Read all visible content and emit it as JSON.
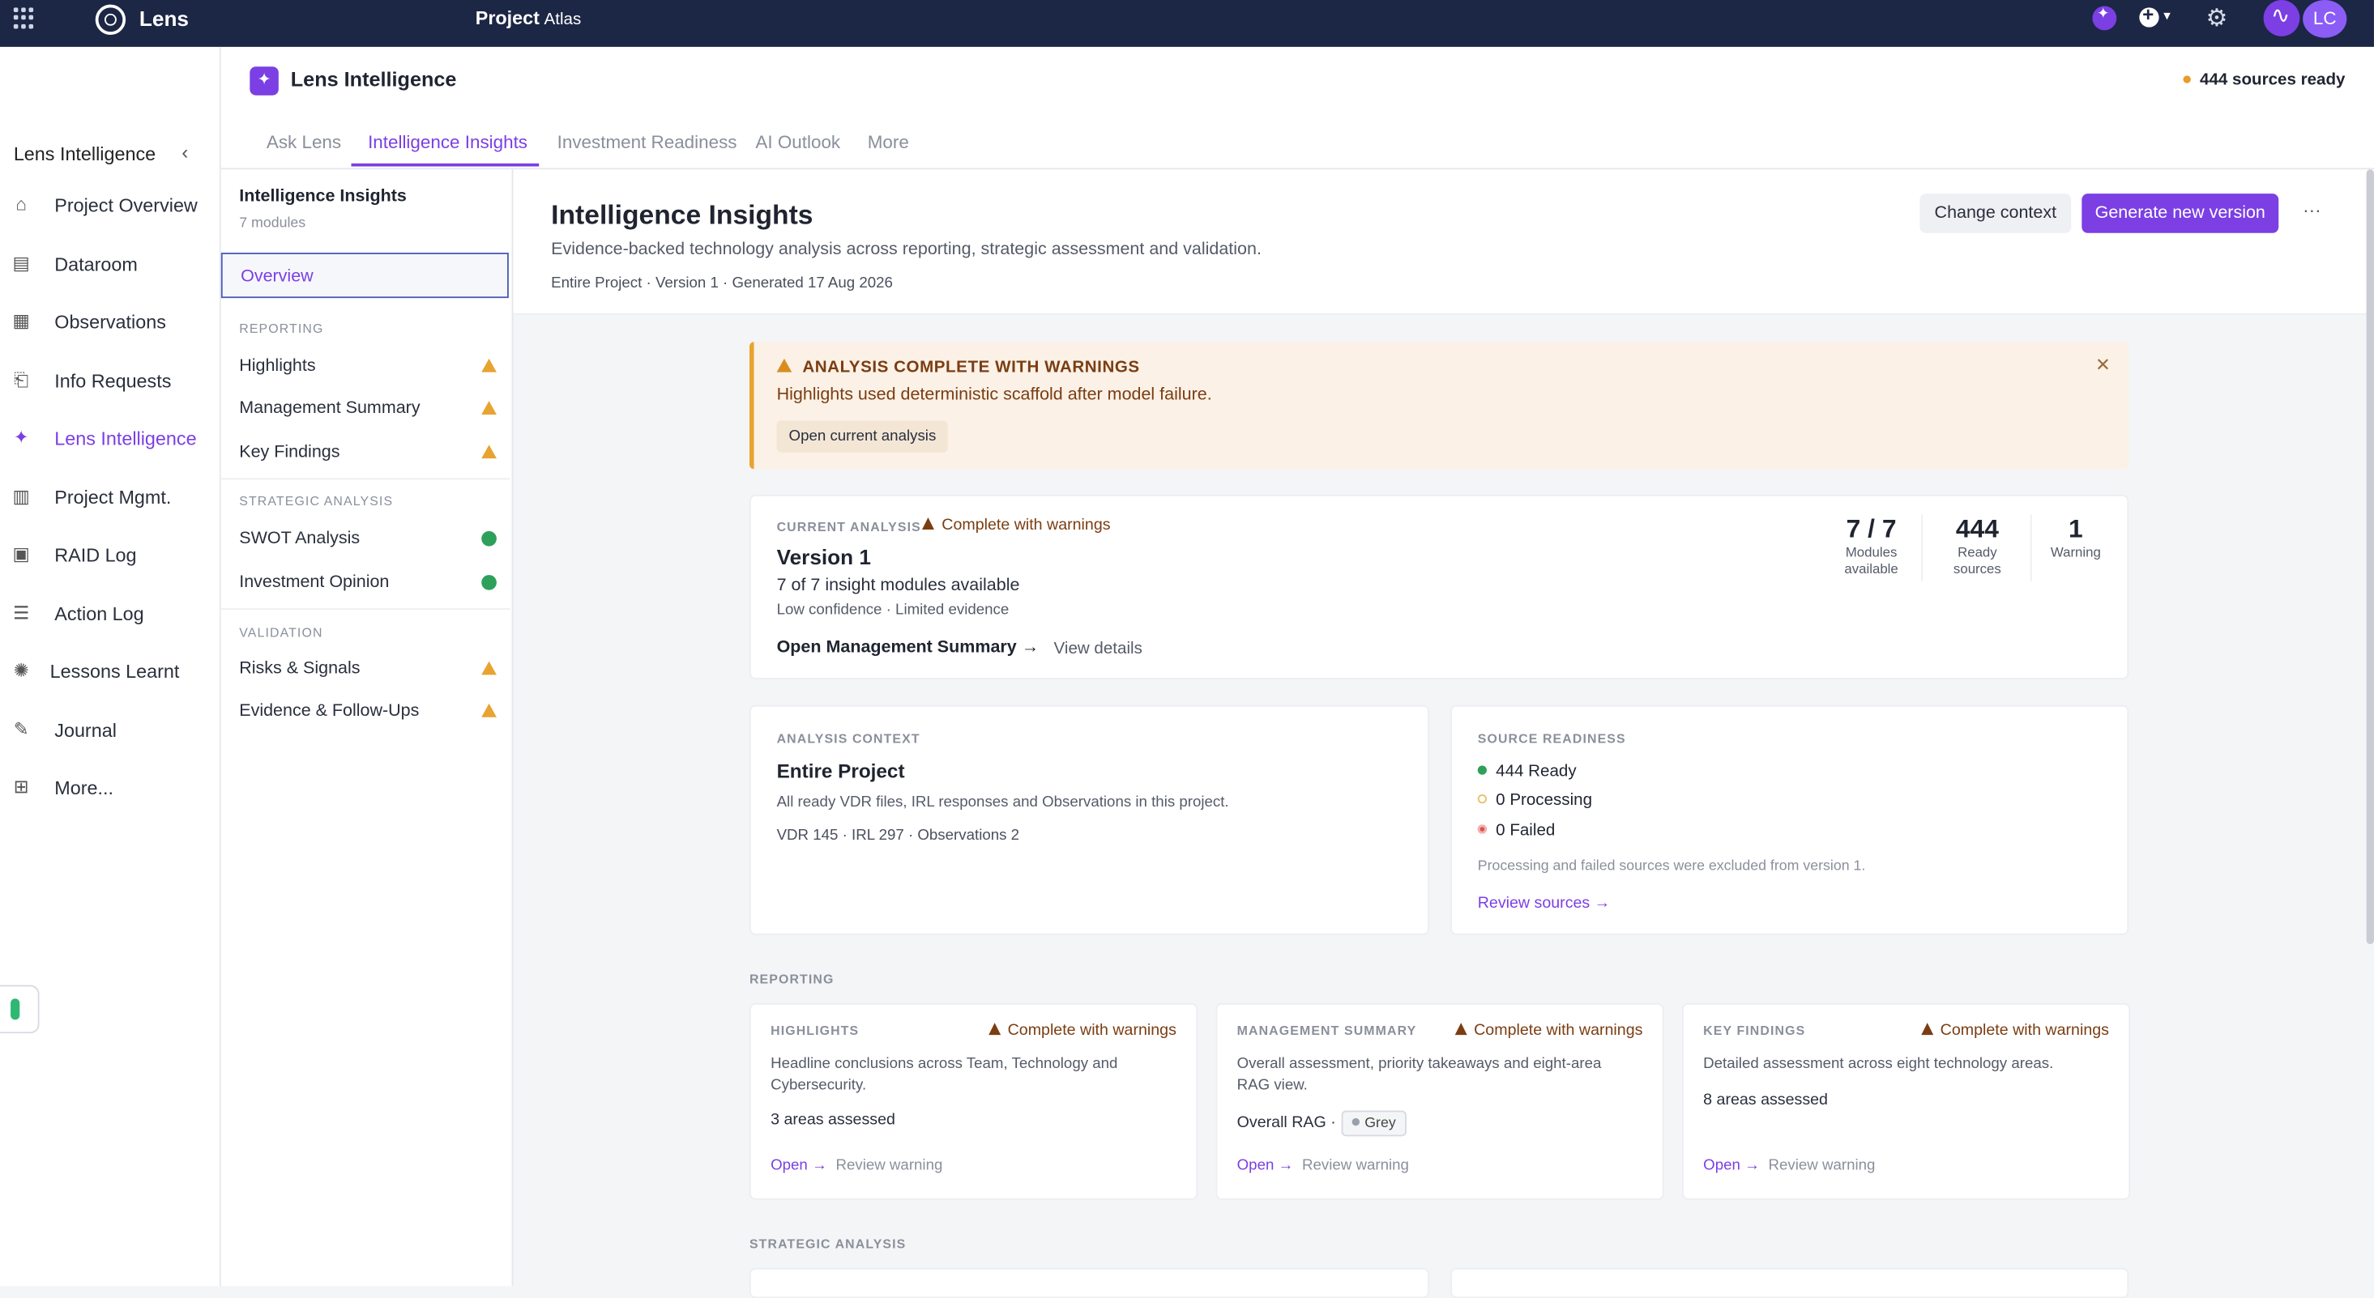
{
  "topbar": {
    "brand": "Lens",
    "project_label": "Project",
    "project_name": "Atlas",
    "avatar": "LC"
  },
  "sidebar": {
    "title": "Lens Intelligence",
    "items": [
      {
        "label": "Project Overview",
        "icon": "home-icon"
      },
      {
        "label": "Dataroom",
        "icon": "dataroom-icon"
      },
      {
        "label": "Observations",
        "icon": "observations-icon"
      },
      {
        "label": "Info Requests",
        "icon": "info-requests-icon"
      },
      {
        "label": "Lens Intelligence",
        "icon": "sparkle-icon",
        "active": true
      },
      {
        "label": "Project Mgmt.",
        "icon": "project-mgmt-icon"
      },
      {
        "label": "RAID Log",
        "icon": "raid-icon"
      },
      {
        "label": "Action Log",
        "icon": "action-log-icon"
      },
      {
        "label": "Lessons Learnt",
        "icon": "bulb-icon"
      },
      {
        "label": "Journal",
        "icon": "journal-icon"
      },
      {
        "label": "More...",
        "icon": "grid-icon"
      }
    ]
  },
  "header": {
    "title": "Lens Intelligence",
    "status": "444 sources ready"
  },
  "tabs": [
    "Ask Lens",
    "Intelligence Insights",
    "Investment Readiness",
    "AI Outlook",
    "More"
  ],
  "modnav": {
    "title": "Intelligence Insights",
    "subtitle": "7 modules",
    "overview": "Overview",
    "sections": [
      {
        "label": "REPORTING",
        "items": [
          {
            "label": "Highlights",
            "status": "warning"
          },
          {
            "label": "Management Summary",
            "status": "warning"
          },
          {
            "label": "Key Findings",
            "status": "warning"
          }
        ]
      },
      {
        "label": "STRATEGIC ANALYSIS",
        "items": [
          {
            "label": "SWOT Analysis",
            "status": "ok"
          },
          {
            "label": "Investment Opinion",
            "status": "ok"
          }
        ]
      },
      {
        "label": "VALIDATION",
        "items": [
          {
            "label": "Risks & Signals",
            "status": "warning"
          },
          {
            "label": "Evidence & Follow-Ups",
            "status": "warning"
          }
        ]
      }
    ]
  },
  "content": {
    "title": "Intelligence Insights",
    "description": "Evidence-backed technology analysis across reporting, strategic assessment and validation.",
    "meta": "Entire Project · Version 1 · Generated 17 Aug 2026",
    "change_context": "Change context",
    "generate": "Generate new version",
    "more": "···"
  },
  "alert": {
    "title": "ANALYSIS COMPLETE WITH WARNINGS",
    "body": "Highlights used deterministic scaffold after model failure.",
    "button": "Open current analysis",
    "close": "✕"
  },
  "current": {
    "eyebrow": "CURRENT ANALYSIS",
    "badge": "Complete with warnings",
    "version": "Version 1",
    "modules": "7 of 7 insight modules available",
    "confidence": "Low confidence · Limited evidence",
    "primary_link": "Open Management Summary →",
    "secondary_link": "View details",
    "stats": [
      {
        "value": "7 / 7",
        "label1": "Modules",
        "label2": "available"
      },
      {
        "value": "444",
        "label1": "Ready",
        "label2": "sources"
      },
      {
        "value": "1",
        "label1": "Warning",
        "label2": ""
      }
    ]
  },
  "context": {
    "eyebrow": "ANALYSIS CONTEXT",
    "title": "Entire Project",
    "desc": "All ready VDR files, IRL responses and Observations in this project.",
    "counts": "VDR 145 · IRL 297 · Observations 2"
  },
  "readiness": {
    "eyebrow": "SOURCE READINESS",
    "ready": "444 Ready",
    "processing": "0 Processing",
    "failed": "0 Failed",
    "note": "Processing and failed sources were excluded from version 1.",
    "link": "Review sources →",
    "colors": {
      "ready": "#2fa05a",
      "processing": "#e8c070",
      "failed": "#d9534f"
    }
  },
  "reporting": {
    "heading": "REPORTING",
    "cards": [
      {
        "eyebrow": "HIGHLIGHTS",
        "badge": "Complete with warnings",
        "desc": "Headline conclusions across Team, Technology and Cybersecurity.",
        "stat": "3 areas assessed",
        "rag": "",
        "open": "Open →",
        "review": "Review warning"
      },
      {
        "eyebrow": "MANAGEMENT SUMMARY",
        "badge": "Complete with warnings",
        "desc": "Overall assessment, priority takeaways and eight-area RAG view.",
        "stat": "Overall RAG ·",
        "rag": "Grey",
        "open": "Open →",
        "review": "Review warning"
      },
      {
        "eyebrow": "KEY FINDINGS",
        "badge": "Complete with warnings",
        "desc": "Detailed assessment across eight technology areas.",
        "stat": "8 areas assessed",
        "rag": "",
        "open": "Open →",
        "review": "Review warning"
      }
    ]
  },
  "strategic_heading": "STRATEGIC ANALYSIS",
  "colors": {
    "accent": "#7b3fe4",
    "topbar": "#1c2645",
    "warning": "#e8a331",
    "ok": "#2fa05a"
  }
}
